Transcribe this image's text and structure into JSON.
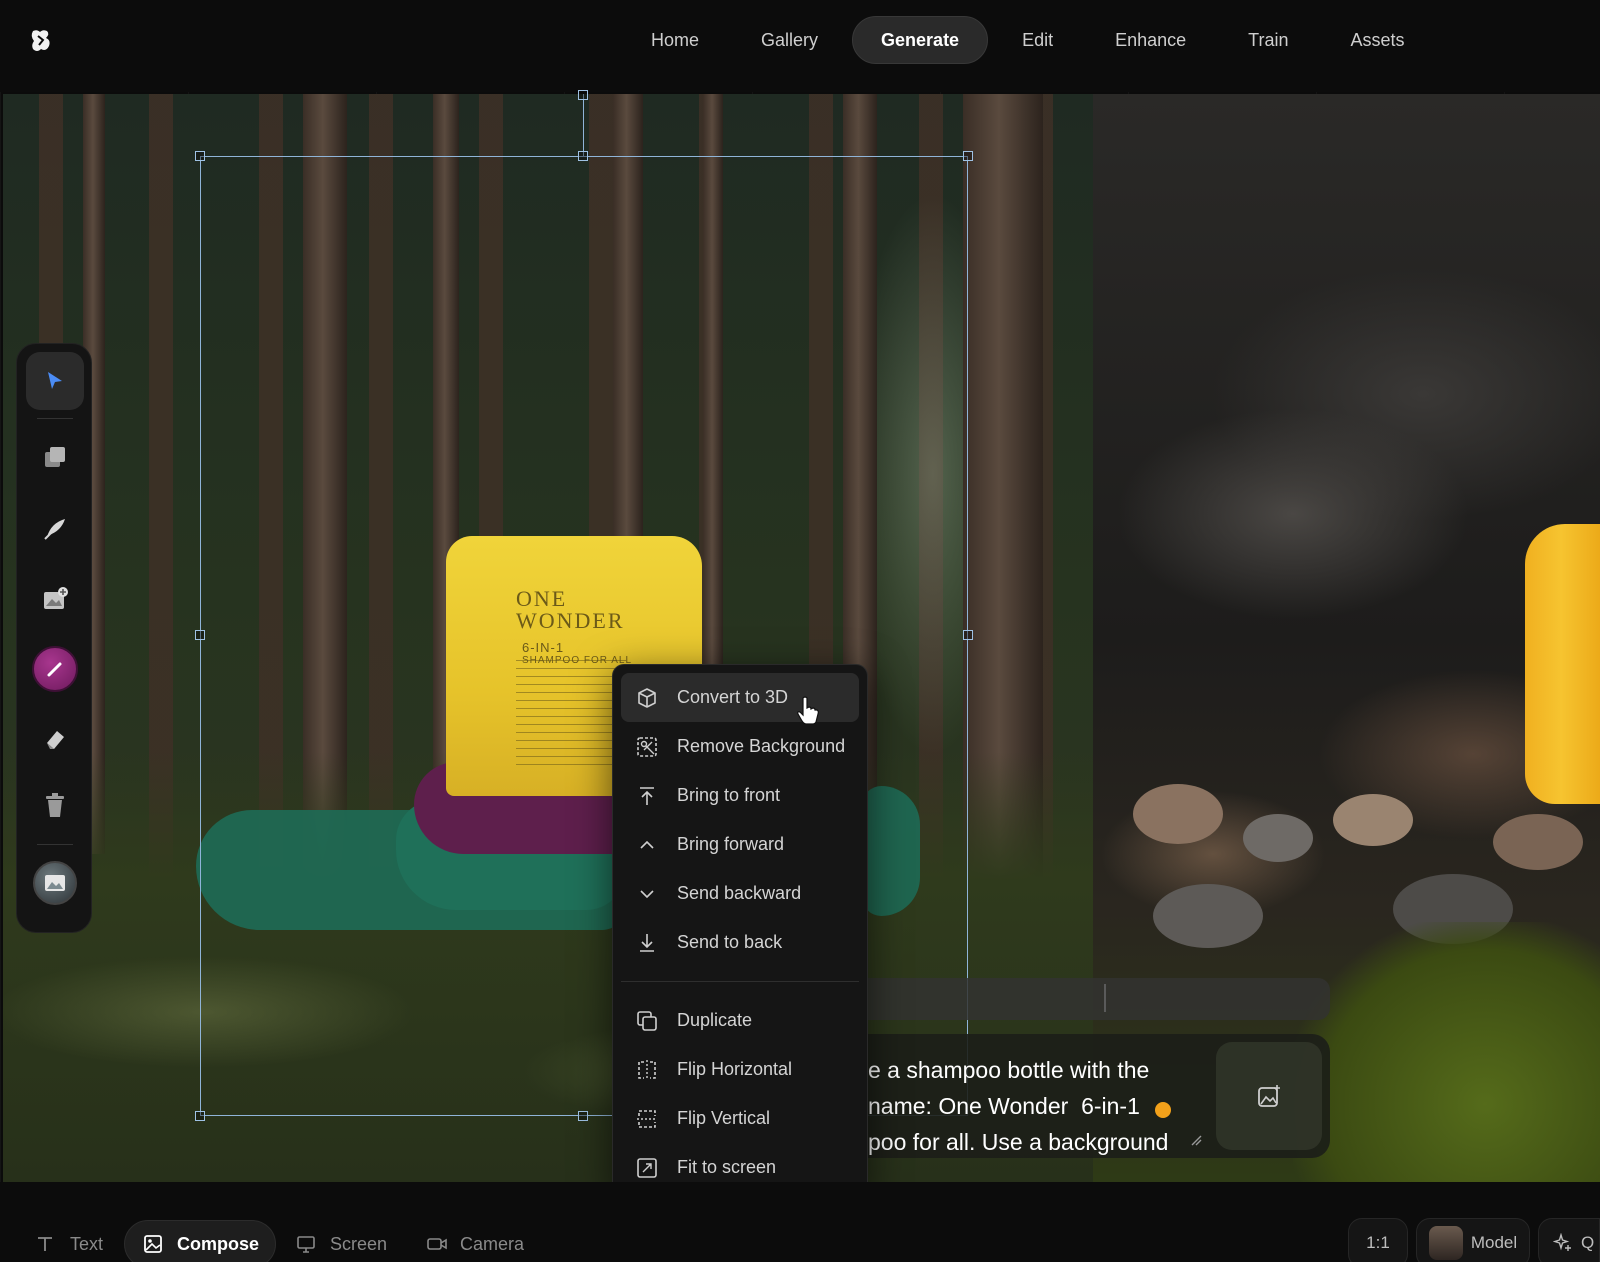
{
  "app": {
    "logo_icon": "app-logo-icon"
  },
  "nav": {
    "items": [
      {
        "label": "Home",
        "active": false
      },
      {
        "label": "Gallery",
        "active": false
      },
      {
        "label": "Generate",
        "active": true
      },
      {
        "label": "Edit",
        "active": false
      },
      {
        "label": "Enhance",
        "active": false
      },
      {
        "label": "Train",
        "active": false
      },
      {
        "label": "Assets",
        "active": false
      }
    ]
  },
  "toolbar": {
    "tools": [
      {
        "name": "select-tool",
        "icon": "pointer-arrow-icon",
        "active": true
      },
      {
        "name": "layers-tool",
        "icon": "layers-icon",
        "active": false
      },
      {
        "name": "draw-tool",
        "icon": "feather-icon",
        "active": false
      },
      {
        "name": "add-image-tool",
        "icon": "image-plus-icon",
        "active": false
      },
      {
        "name": "brush-tool",
        "icon": "brush-icon",
        "active": false
      },
      {
        "name": "eraser-tool",
        "icon": "eraser-icon",
        "active": false
      },
      {
        "name": "delete-tool",
        "icon": "trash-icon",
        "active": false
      },
      {
        "name": "image-tool",
        "icon": "photo-icon",
        "active": false
      }
    ]
  },
  "canvas": {
    "shampoo_brand_line1": "ONE",
    "shampoo_brand_line2": "WONDER",
    "shampoo_subtitle": "6-IN-1",
    "shampoo_tagline": "SHAMPOO FOR ALL"
  },
  "context_menu": {
    "group1": [
      {
        "label": "Convert to 3D",
        "icon": "cube-icon",
        "hover": true
      },
      {
        "label": "Remove Background",
        "icon": "remove-background-icon",
        "hover": false
      },
      {
        "label": "Bring to front",
        "icon": "arrow-up-to-line-icon",
        "hover": false
      },
      {
        "label": "Bring forward",
        "icon": "chevron-up-icon",
        "hover": false
      },
      {
        "label": "Send backward",
        "icon": "chevron-down-icon",
        "hover": false
      },
      {
        "label": "Send to back",
        "icon": "arrow-down-to-line-icon",
        "hover": false
      }
    ],
    "group2": [
      {
        "label": "Duplicate",
        "icon": "duplicate-icon"
      },
      {
        "label": "Flip Horizontal",
        "icon": "flip-horizontal-icon"
      },
      {
        "label": "Flip Vertical",
        "icon": "flip-vertical-icon"
      },
      {
        "label": "Fit to screen",
        "icon": "fit-screen-icon"
      }
    ]
  },
  "prompt": {
    "text": "e a shampoo bottle with the\nname: One Wonder  6-in-1\npoo for all. Use a background",
    "status_color": "#f2a11a"
  },
  "bottombar": {
    "modes": [
      {
        "label": "Text",
        "icon": "text-icon",
        "active": false
      },
      {
        "label": "Compose",
        "icon": "image-icon",
        "active": true
      },
      {
        "label": "Screen",
        "icon": "monitor-icon",
        "active": false
      },
      {
        "label": "Camera",
        "icon": "video-camera-icon",
        "active": false
      }
    ],
    "aspect_ratio": "1:1",
    "model_label": "Model",
    "quality_label": "Q"
  },
  "colors": {
    "accent_pink": "#a8368e",
    "selection": "#8fb4d8",
    "status_orange": "#f2a11a"
  }
}
